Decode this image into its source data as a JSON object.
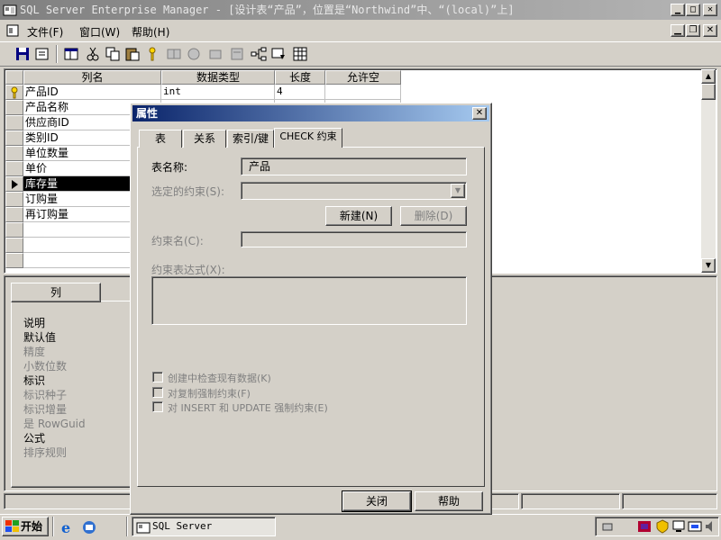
{
  "window": {
    "title": "SQL Server Enterprise Manager - [设计表“产品”，位置是“Northwind”中、“(local)”上]"
  },
  "menu": {
    "items": [
      {
        "label": "文件(F)"
      },
      {
        "label": "窗口(W)"
      },
      {
        "label": "帮助(H)"
      }
    ]
  },
  "grid": {
    "columns": [
      "列名",
      "数据类型",
      "长度",
      "允许空"
    ],
    "rows": [
      {
        "name": "产品ID",
        "type": "int",
        "length": "4",
        "nullable": "",
        "key": true
      },
      {
        "name": "产品名称",
        "type": "",
        "length": "",
        "nullable": ""
      },
      {
        "name": "供应商ID",
        "type": "",
        "length": "",
        "nullable": ""
      },
      {
        "name": "类别ID",
        "type": "",
        "length": "",
        "nullable": ""
      },
      {
        "name": "单位数量",
        "type": "",
        "length": "",
        "nullable": ""
      },
      {
        "name": "单价",
        "type": "",
        "length": "",
        "nullable": ""
      },
      {
        "name": "库存量",
        "type": "",
        "length": "",
        "nullable": "",
        "selected": true
      },
      {
        "name": "订购量",
        "type": "",
        "length": "",
        "nullable": ""
      },
      {
        "name": "再订购量",
        "type": "",
        "length": "",
        "nullable": ""
      }
    ]
  },
  "bottom_pane": {
    "tab_label": "列",
    "properties": [
      {
        "label": "说明",
        "enabled": true
      },
      {
        "label": "默认值",
        "enabled": true
      },
      {
        "label": "精度",
        "enabled": false
      },
      {
        "label": "小数位数",
        "enabled": false
      },
      {
        "label": "标识",
        "enabled": true
      },
      {
        "label": "标识种子",
        "enabled": false
      },
      {
        "label": "标识增量",
        "enabled": false
      },
      {
        "label": "是 RowGuid",
        "enabled": false
      },
      {
        "label": "公式",
        "enabled": true
      },
      {
        "label": "排序规则",
        "enabled": false
      }
    ]
  },
  "dialog": {
    "title": "属性",
    "tabs": [
      "表",
      "关系",
      "索引/键",
      "CHECK 约束"
    ],
    "active_tab": "CHECK 约束",
    "table_name_label": "表名称:",
    "table_name_value": "产品",
    "selected_constraint_label": "选定的约束(S):",
    "new_button": "新建(N)",
    "delete_button": "删除(D)",
    "constraint_name_label": "约束名(C):",
    "constraint_expr_label": "约束表达式(X):",
    "checkboxes": [
      "创建中检查现有数据(K)",
      "对复制强制约束(F)",
      "对 INSERT 和 UPDATE 强制约束(E)"
    ],
    "close_button": "关闭",
    "help_button": "帮助"
  },
  "taskbar": {
    "start_label": "开始",
    "task_label": "SQL Server Enterpri..."
  },
  "icons": {
    "app": "mmc-console-icon",
    "key": "primary-key-icon"
  },
  "colors": {
    "dialog_title": "#0a246a",
    "selection": "#000000",
    "face": "#d4d0c8"
  }
}
